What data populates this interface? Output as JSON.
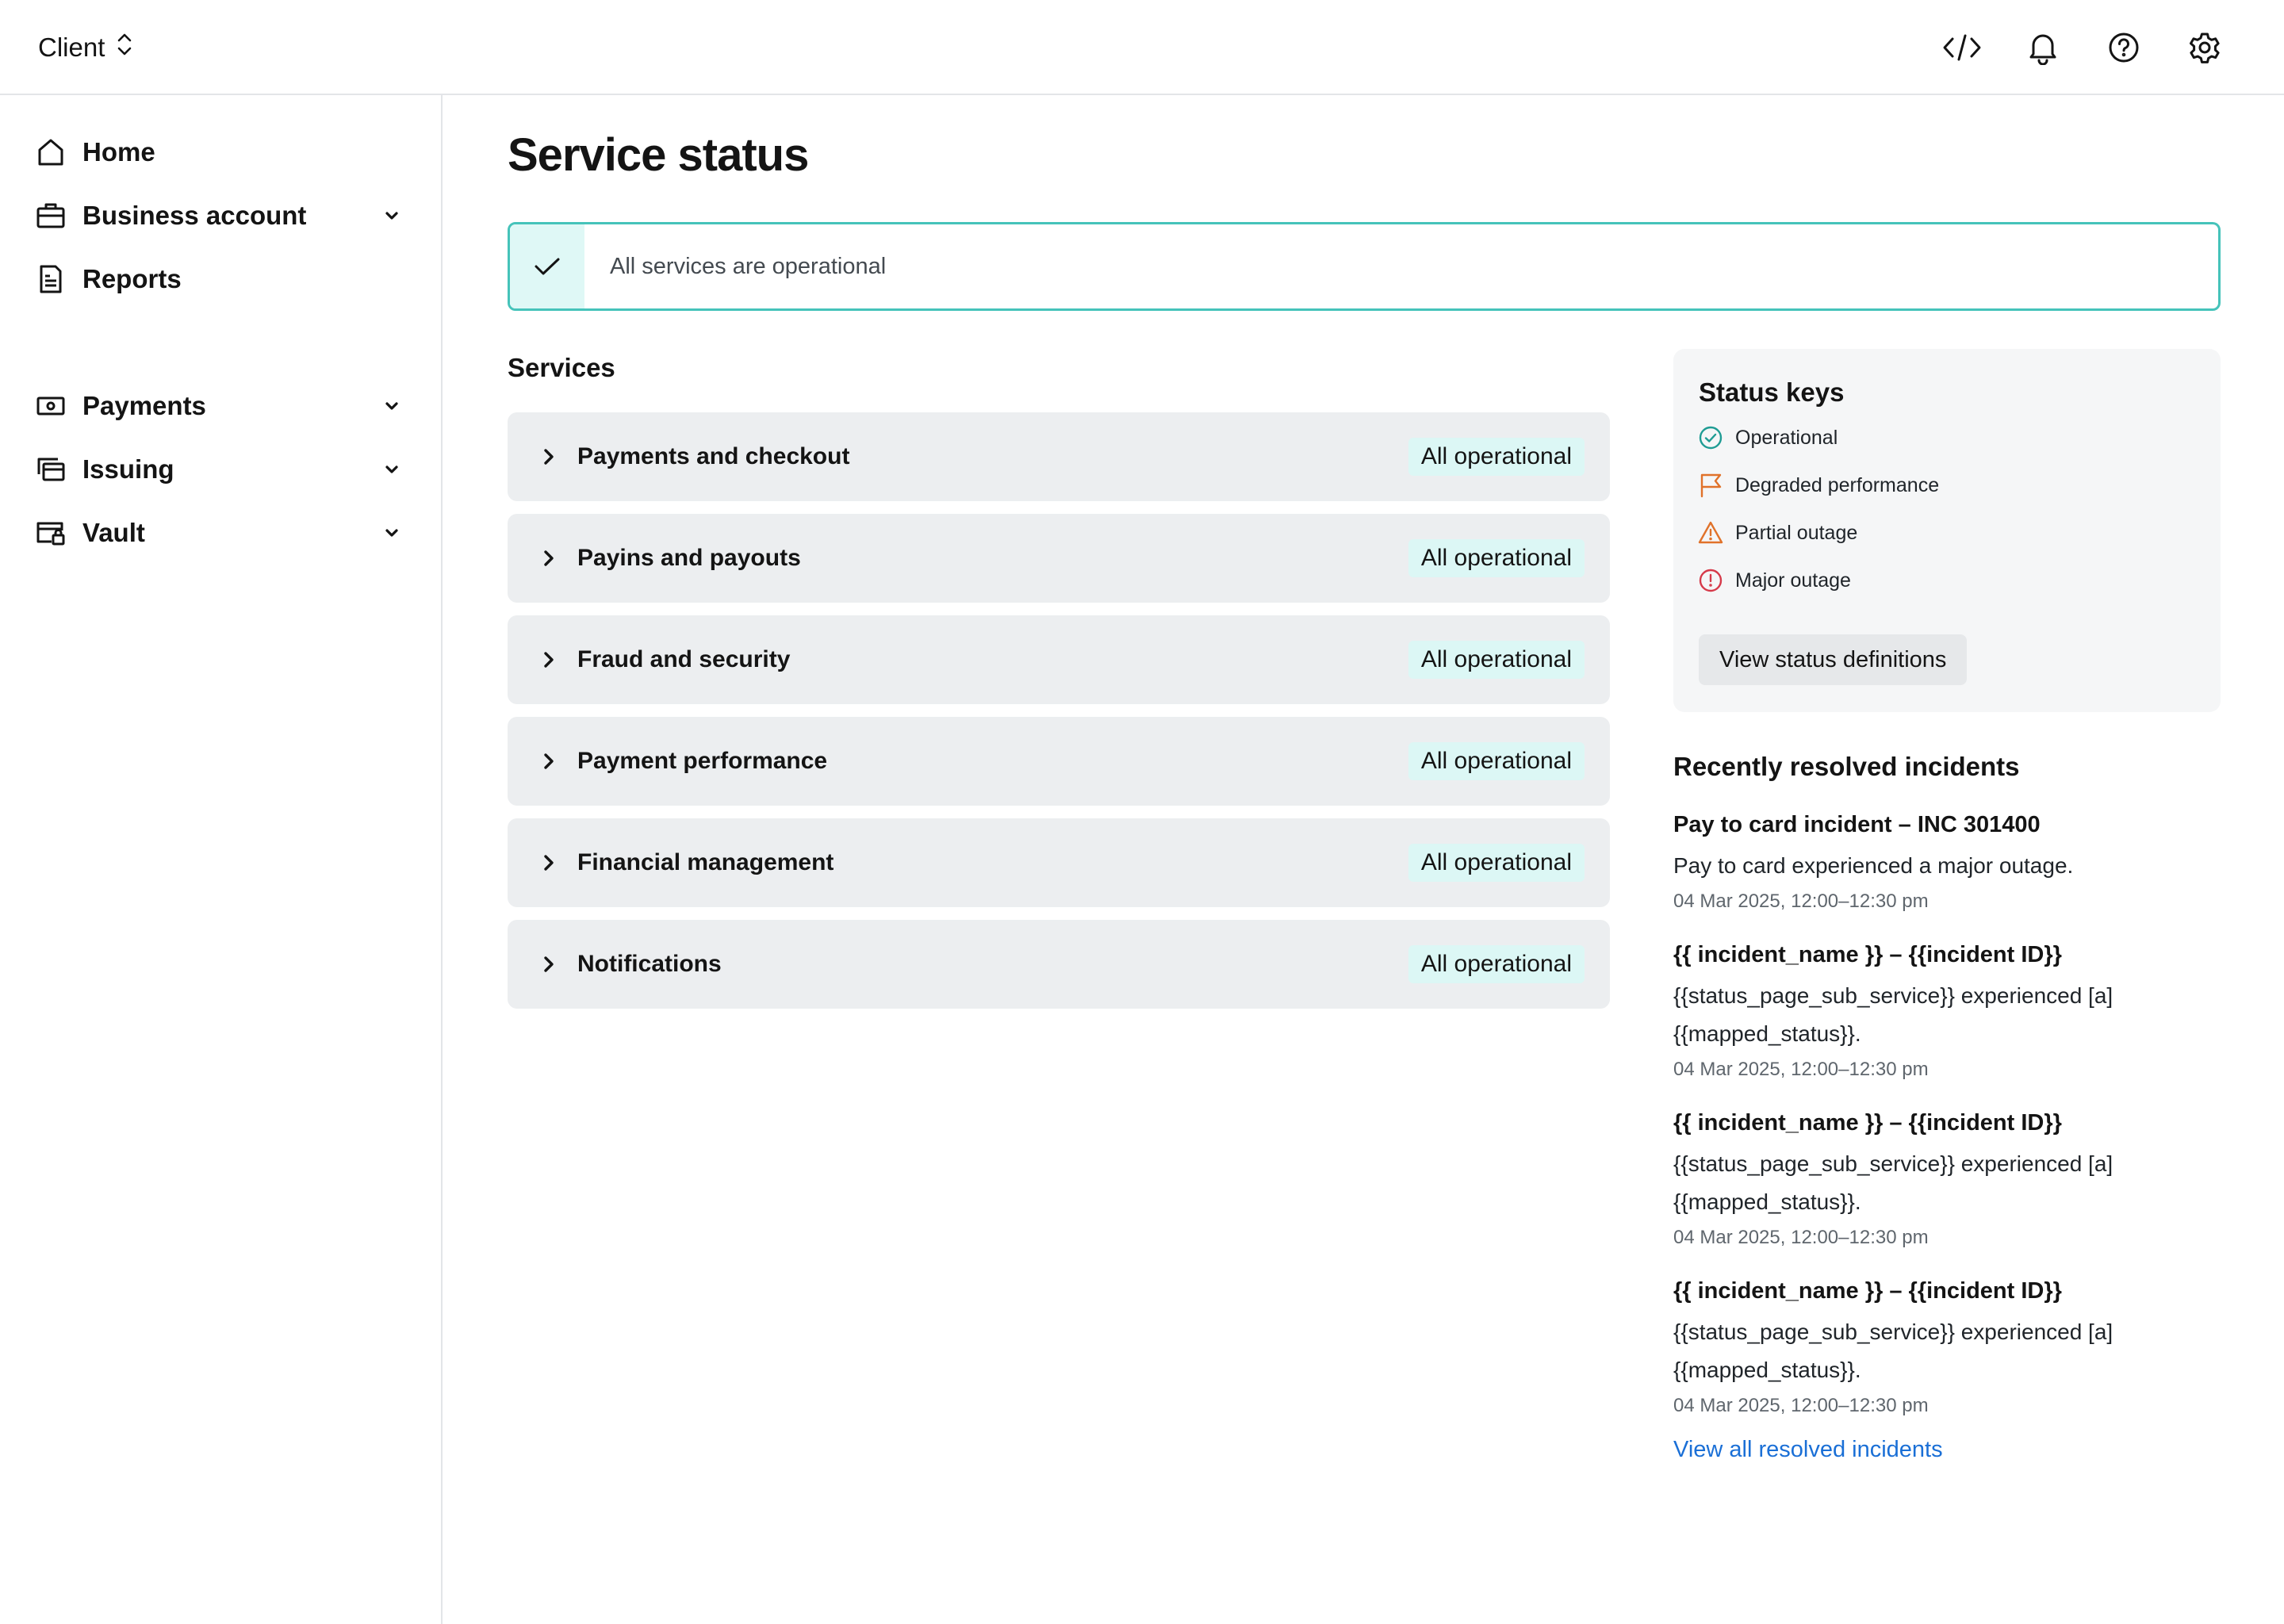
{
  "header": {
    "client_label": "Client",
    "icons": [
      "code-icon",
      "bell-icon",
      "help-icon",
      "gear-icon"
    ]
  },
  "sidebar": {
    "items": [
      {
        "label": "Home",
        "icon": "home-icon",
        "expandable": false
      },
      {
        "label": "Business account",
        "icon": "briefcase-icon",
        "expandable": true
      },
      {
        "label": "Reports",
        "icon": "report-icon",
        "expandable": false
      },
      {
        "label": "Payments",
        "icon": "money-icon",
        "expandable": true
      },
      {
        "label": "Issuing",
        "icon": "cards-icon",
        "expandable": true
      },
      {
        "label": "Vault",
        "icon": "vault-icon",
        "expandable": true
      }
    ]
  },
  "main": {
    "title": "Service status",
    "banner_text": "All services are operational",
    "services_heading": "Services",
    "services": [
      {
        "name": "Payments and checkout",
        "status": "All operational"
      },
      {
        "name": "Payins and payouts",
        "status": "All operational"
      },
      {
        "name": "Fraud and security",
        "status": "All operational"
      },
      {
        "name": "Payment performance",
        "status": "All operational"
      },
      {
        "name": "Financial management",
        "status": "All operational"
      },
      {
        "name": "Notifications",
        "status": "All operational"
      }
    ]
  },
  "status_keys": {
    "title": "Status keys",
    "items": [
      {
        "label": "Operational",
        "icon": "check-circle-icon",
        "color": "#1f9c94"
      },
      {
        "label": "Degraded performance",
        "icon": "flag-icon",
        "color": "#e0722a"
      },
      {
        "label": "Partial outage",
        "icon": "warning-icon",
        "color": "#e0722a"
      },
      {
        "label": "Major outage",
        "icon": "alert-circle-icon",
        "color": "#d63a4a"
      }
    ],
    "button_label": "View status definitions"
  },
  "incidents": {
    "heading": "Recently resolved incidents",
    "items": [
      {
        "title": "Pay to card incident – INC 301400",
        "desc_line1": "Pay to card experienced a major outage.",
        "desc_line2": "",
        "time": "04 Mar 2025, 12:00–12:30 pm"
      },
      {
        "title": "{{ incident_name }} – {{incident ID}}",
        "desc_line1": "{{status_page_sub_service}} experienced [a]",
        "desc_line2": "{{mapped_status}}.",
        "time": "04 Mar 2025, 12:00–12:30 pm"
      },
      {
        "title": "{{ incident_name }} – {{incident ID}}",
        "desc_line1": "{{status_page_sub_service}} experienced [a]",
        "desc_line2": "{{mapped_status}}.",
        "time": "04 Mar 2025, 12:00–12:30 pm"
      },
      {
        "title": "{{ incident_name }} – {{incident ID}}",
        "desc_line1": "{{status_page_sub_service}} experienced [a]",
        "desc_line2": "{{mapped_status}}.",
        "time": "04 Mar 2025, 12:00–12:30 pm"
      }
    ],
    "view_all_label": "View all resolved incidents"
  },
  "colors": {
    "accent_teal": "#45c3ba",
    "badge_bg": "#dcf7f5",
    "link_blue": "#1a6fd6"
  }
}
